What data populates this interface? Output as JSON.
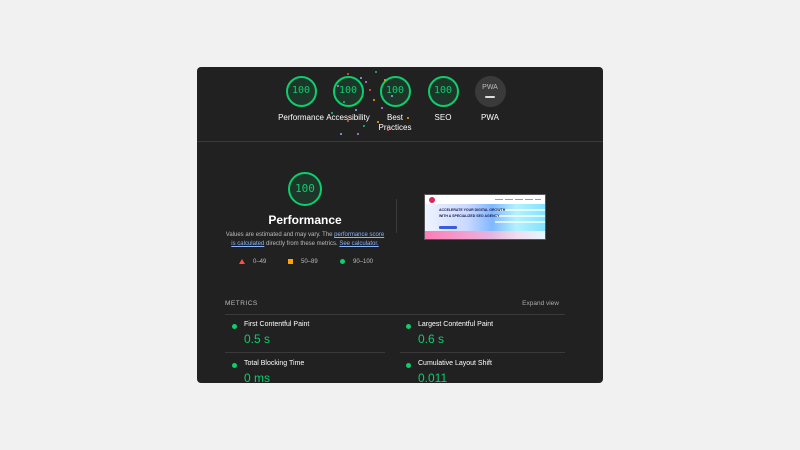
{
  "gauges": [
    {
      "label": "Performance",
      "score": "100"
    },
    {
      "label": "Accessibility",
      "score": "100"
    },
    {
      "label": "Best Practices",
      "score": "100"
    },
    {
      "label": "SEO",
      "score": "100"
    },
    {
      "label": "PWA",
      "score": "PWA"
    }
  ],
  "performance": {
    "score": "100",
    "title": "Performance",
    "desc_prefix": "Values are estimated and may vary. The ",
    "desc_link1": "performance score is calculated",
    "desc_middle": " directly from these metrics. ",
    "desc_link2": "See calculator."
  },
  "legend": {
    "poor": "0–49",
    "average": "50–89",
    "good": "90–100"
  },
  "screenshot": {
    "headline1": "ACCELERATE YOUR DIGITAL GROWTH",
    "headline2": "WITH A SPECIALIZED SEO AGENCY"
  },
  "metrics": {
    "section_label": "METRICS",
    "expand_label": "Expand view",
    "items": [
      {
        "name": "First Contentful Paint",
        "value": "0.5 s"
      },
      {
        "name": "Largest Contentful Paint",
        "value": "0.6 s"
      },
      {
        "name": "Total Blocking Time",
        "value": "0 ms"
      },
      {
        "name": "Cumulative Layout Shift",
        "value": "0.011"
      }
    ]
  },
  "colors": {
    "good": "#0cce6b",
    "average": "#ffa400",
    "poor": "#ff4e42",
    "link": "#8ab4f8",
    "panel": "#212121"
  }
}
